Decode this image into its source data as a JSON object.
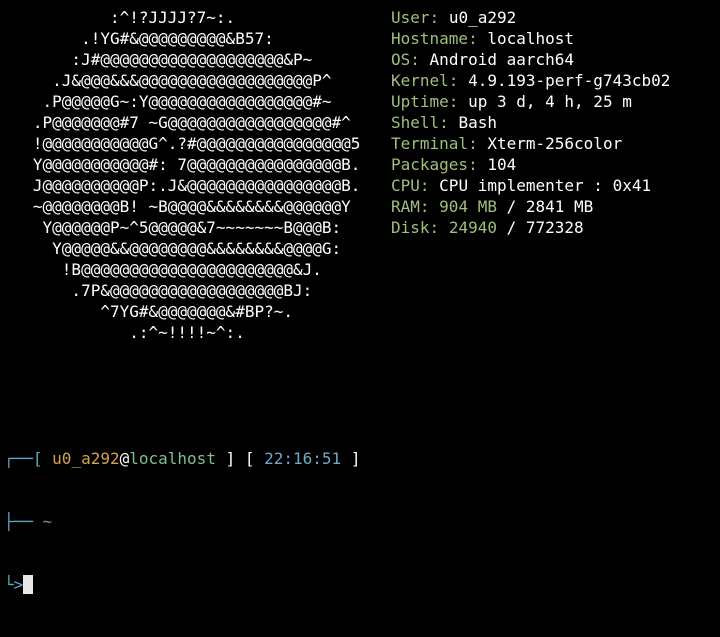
{
  "logo_lines": [
    "           :^!?JJJJ?7~:.",
    "        .!YG#&@@@@@@@@@&B57:",
    "       :J#@@@@@@@@@@@@@@@@@@@&P~",
    "     .J&@@@&&&@@@@@@@@@@@@@@@@@@P^",
    "    .P@@@@@G~:Y@@@@@@@@@@@@@@@@@#~",
    "   .P@@@@@@@#7 ~G@@@@@@@@@@@@@@@@@#^",
    "   !@@@@@@@@@@@G^.?#@@@@@@@@@@@@@@@@5",
    "   Y@@@@@@@@@@@#: 7@@@@@@@@@@@@@@@@B.",
    "   J@@@@@@@@@@P:.J&@@@@@@@@@@@@@@@@B.",
    "   ~@@@@@@@@B! ~B@@@@&&&&&&&&@@@@@@Y",
    "    Y@@@@@@P~^5@@@@@&7~~~~~~~B@@@B:",
    "     Y@@@@@&&@@@@@@@@&&&&&&&&@@@@G:",
    "      !B@@@@@@@@@@@@@@@@@@@@@@&J.",
    "       .7P&@@@@@@@@@@@@@@@@@@BJ:",
    "          ^7YG#&@@@@@@@&#BP?~.",
    "             .:^~!!!!~^:."
  ],
  "info": [
    {
      "key": "User:",
      "value": "u0_a292",
      "hl": "",
      "rest": ""
    },
    {
      "key": "Hostname:",
      "value": "localhost",
      "hl": "",
      "rest": ""
    },
    {
      "key": "OS:",
      "value": "Android aarch64",
      "hl": "",
      "rest": ""
    },
    {
      "key": "Kernel:",
      "value": "4.9.193-perf-g743cb02",
      "hl": "",
      "rest": ""
    },
    {
      "key": "Uptime:",
      "value": "up 3 d, 4 h, 25 m",
      "hl": "",
      "rest": ""
    },
    {
      "key": "Shell:",
      "value": "Bash",
      "hl": "",
      "rest": ""
    },
    {
      "key": "Terminal:",
      "value": "Xterm-256color",
      "hl": "",
      "rest": ""
    },
    {
      "key": "Packages:",
      "value": "104",
      "hl": "",
      "rest": ""
    },
    {
      "key": "CPU:",
      "value": "CPU implementer : 0x41",
      "hl": "",
      "rest": ""
    },
    {
      "key": "RAM:",
      "value": "",
      "hl": "904 MB",
      "rest": "/ 2841 MB"
    },
    {
      "key": "Disk:",
      "value": "",
      "hl": "24940",
      "rest": "/ 772328"
    }
  ],
  "prompt": {
    "frame_top": "┌──[ ",
    "user": "u0_a292",
    "at": "@",
    "host": "localhost",
    "mid": " ] [ ",
    "time": "22:16:51",
    "end": " ]",
    "frame_mid": "├── ",
    "dir": "~",
    "frame_bot": "└>"
  },
  "colors": {
    "background": "#000000",
    "key_green": "#9fbf7a",
    "frame_blue": "#5fa8c8",
    "user_orange": "#d4a24c",
    "host_green": "#7fbf8f",
    "time_blue": "#6fa8c8"
  }
}
